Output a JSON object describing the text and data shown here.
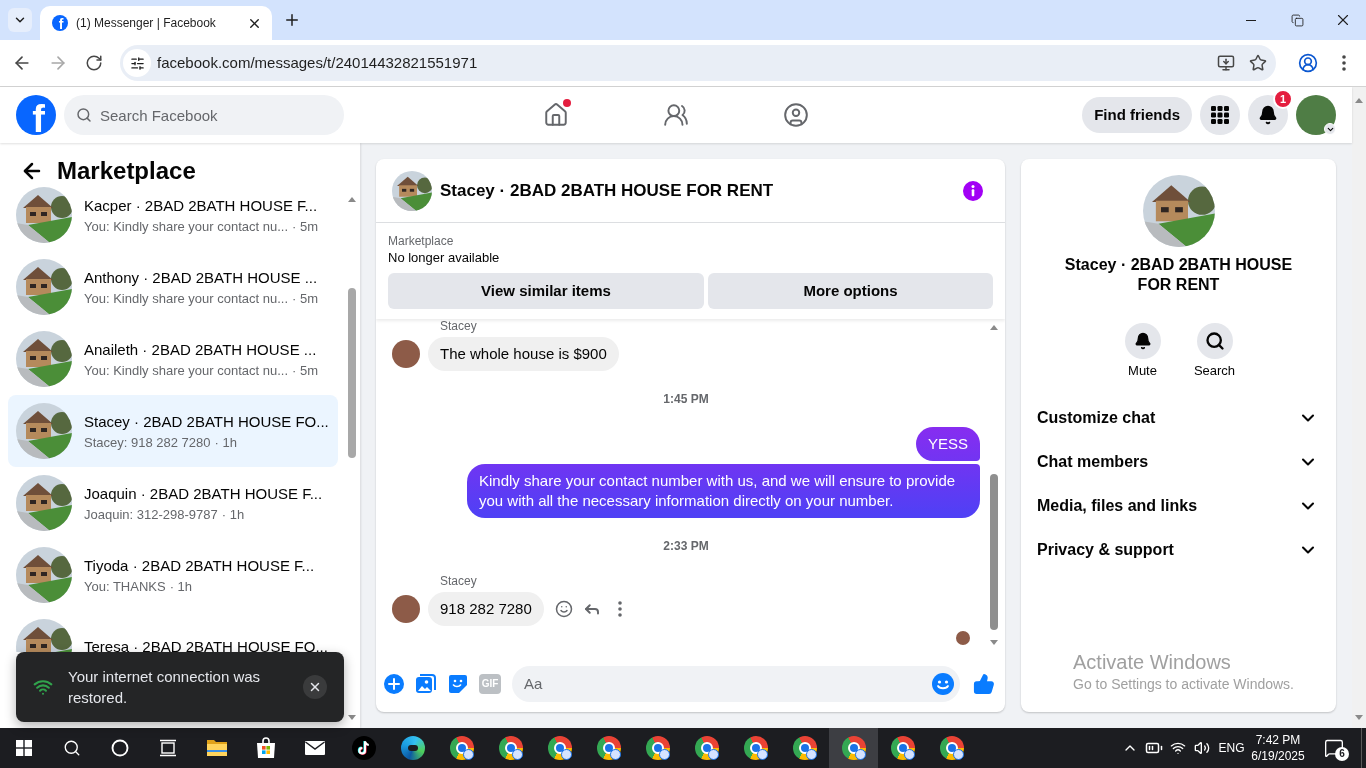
{
  "browser": {
    "tabs": [
      {
        "title": "(1) Messenger | Facebook",
        "favicon_letter": "f",
        "selected": true
      }
    ],
    "nav_buttons": [
      {
        "kind": "back",
        "disabled": false
      },
      {
        "kind": "forward",
        "disabled": true
      },
      {
        "kind": "reload",
        "disabled": false
      }
    ],
    "url": "facebook.com/messages/t/24014432821551971"
  },
  "header": {
    "logo_letter": "f",
    "search": {
      "placeholder": "Search Facebook"
    },
    "nav_tabs": [
      {
        "kind": "home",
        "selected": false,
        "notification_dot": true
      },
      {
        "kind": "friends",
        "selected": false,
        "notification_dot": false
      },
      {
        "kind": "groups",
        "selected": false,
        "notification_dot": false
      }
    ],
    "find_friends": "Find friends",
    "notification_count": "1"
  },
  "sidebar": {
    "title": "Marketplace",
    "conversations": [
      {
        "name": "Kacper · 2BAD 2BATH HOUSE F...",
        "preview": "You: Kindly share your contact nu...",
        "time": "· 5m",
        "selected": false
      },
      {
        "name": "Anthony · 2BAD 2BATH HOUSE ...",
        "preview": "You: Kindly share your contact nu...",
        "time": "· 5m",
        "selected": false
      },
      {
        "name": "Anaileth · 2BAD 2BATH HOUSE ...",
        "preview": "You: Kindly share your contact nu...",
        "time": "· 5m",
        "selected": false
      },
      {
        "name": "Stacey · 2BAD 2BATH HOUSE FO...",
        "preview": "Stacey: 918 282 7280",
        "time": "· 1h",
        "selected": true
      },
      {
        "name": "Joaquin · 2BAD 2BATH HOUSE F...",
        "preview": "Joaquin: 312-298-9787",
        "time": "· 1h",
        "selected": false
      },
      {
        "name": "Tiyoda · 2BAD 2BATH HOUSE F...",
        "preview": "You: THANKS",
        "time": "· 1h",
        "selected": false
      },
      {
        "name": "Teresa · 2BAD 2BATH HOUSE FO...",
        "selected": false
      }
    ]
  },
  "toast": {
    "text": "Your internet connection was restored."
  },
  "chat": {
    "title": "Stacey · 2BAD 2BATH HOUSE FOR RENT",
    "listing": {
      "source": "Marketplace",
      "status": "No longer available",
      "actions": [
        "View similar items",
        "More options"
      ]
    },
    "messages": [
      {
        "kind": "sender",
        "text": "Stacey"
      },
      {
        "kind": "incoming",
        "text": "The whole house is $900",
        "actions_shown": false
      },
      {
        "kind": "time",
        "text": "1:45 PM"
      },
      {
        "kind": "outgoing",
        "text": "YESS"
      },
      {
        "kind": "outgoing",
        "text": "Kindly share your contact number with us, and we will ensure to provide you with all the necessary information directly on your number."
      },
      {
        "kind": "time",
        "text": "2:33 PM"
      },
      {
        "kind": "sender",
        "text": "Stacey"
      },
      {
        "kind": "incoming",
        "text": "918 282 7280",
        "actions_shown": true
      },
      {
        "kind": "seen"
      }
    ],
    "composer": {
      "placeholder": "Aa",
      "gif_label": "GIF"
    }
  },
  "details": {
    "name": "Stacey · 2BAD 2BATH HOUSE FOR RENT",
    "actions": [
      {
        "kind": "mute",
        "label": "Mute"
      },
      {
        "kind": "search",
        "label": "Search"
      }
    ],
    "sections": [
      {
        "label": "Customize chat",
        "expanded": false
      },
      {
        "label": "Chat members",
        "expanded": false
      },
      {
        "label": "Media, files and links",
        "expanded": false
      },
      {
        "label": "Privacy & support",
        "expanded": false
      }
    ]
  },
  "activation_notice": {
    "title": "Activate Windows",
    "subtitle": "Go to Settings to activate Windows."
  },
  "taskbar": {
    "buttons": [
      {
        "kind": "start"
      },
      {
        "kind": "search"
      },
      {
        "kind": "cortana"
      },
      {
        "kind": "task_view"
      }
    ],
    "apps": [
      {
        "kind": "file_explorer",
        "selected": false
      },
      {
        "kind": "store",
        "selected": false
      },
      {
        "kind": "mail",
        "selected": false
      },
      {
        "kind": "tiktok",
        "selected": false
      },
      {
        "kind": "edge",
        "selected": false
      },
      {
        "kind": "chrome",
        "selected": false
      },
      {
        "kind": "chrome",
        "selected": false
      },
      {
        "kind": "chrome",
        "selected": false
      },
      {
        "kind": "chrome",
        "selected": false
      },
      {
        "kind": "chrome",
        "selected": false
      },
      {
        "kind": "chrome",
        "selected": false
      },
      {
        "kind": "chrome",
        "selected": false
      },
      {
        "kind": "chrome",
        "selected": false
      },
      {
        "kind": "chrome",
        "selected": true
      },
      {
        "kind": "chrome",
        "selected": false
      },
      {
        "kind": "chrome",
        "selected": false
      }
    ],
    "tray": {
      "language": "ENG",
      "time": "7:42 PM",
      "date": "6/19/2025",
      "notification_count": "6"
    }
  }
}
